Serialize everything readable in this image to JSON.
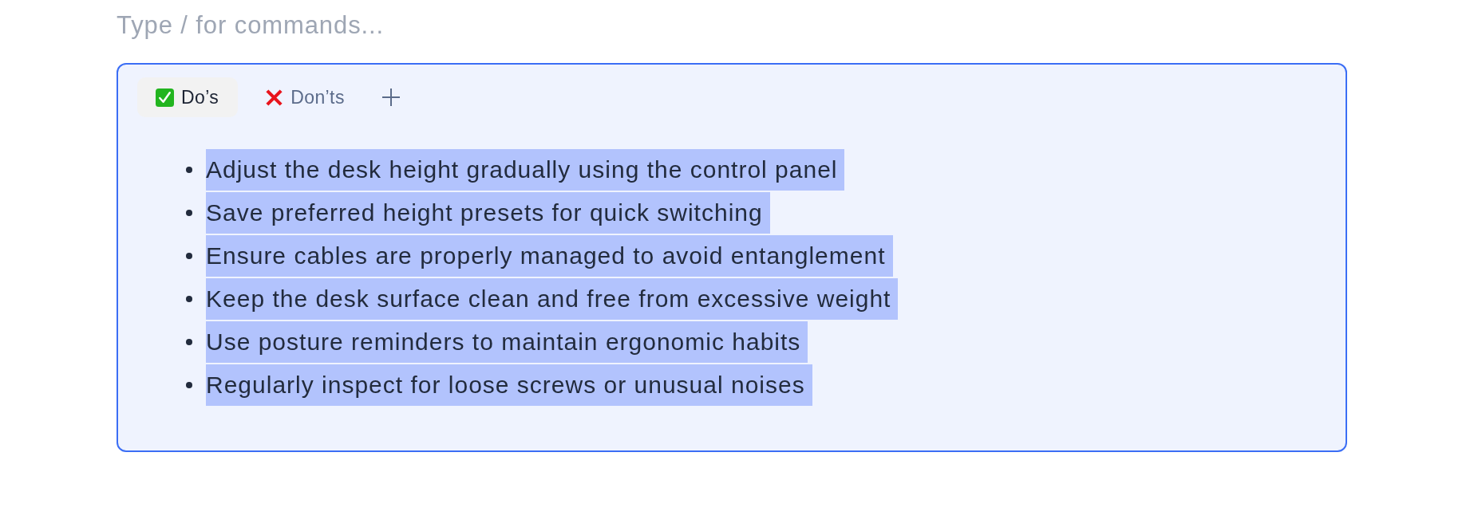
{
  "editor": {
    "placeholder": "Type / for commands..."
  },
  "block": {
    "tabs": [
      {
        "label": "Do’s",
        "kind": "positive",
        "selected": true
      },
      {
        "label": "Don’ts",
        "kind": "negative",
        "selected": false
      }
    ],
    "items": [
      {
        "text": "Adjust the desk height gradually using the control panel",
        "highlighted": true
      },
      {
        "text": "Save preferred height presets for quick switching",
        "highlighted": true
      },
      {
        "text": "Ensure cables are properly managed to avoid entanglement",
        "highlighted": true
      },
      {
        "text": "Keep the desk surface clean and free from excessive weight",
        "highlighted": true
      },
      {
        "text": "Use posture reminders to maintain ergonomic habits",
        "highlighted": true
      },
      {
        "text": "Regularly inspect for loose screws or unusual noises",
        "highlighted": true
      }
    ]
  }
}
